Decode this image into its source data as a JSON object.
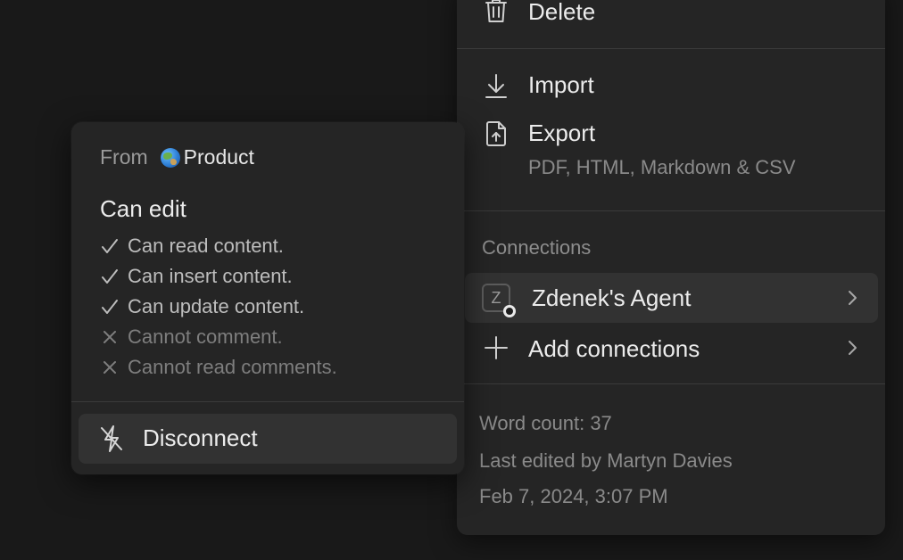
{
  "menu": {
    "delete_label": "Delete",
    "import_label": "Import",
    "export_label": "Export",
    "export_subtext": "PDF, HTML, Markdown & CSV",
    "connections_title": "Connections",
    "agent_initial": "Z",
    "agent_label": "Zdenek's Agent",
    "add_connections_label": "Add connections",
    "word_count": "Word count: 37",
    "last_edited_by": "Last edited by Martyn Davies",
    "last_edited_date": "Feb 7, 2024, 3:07 PM"
  },
  "popover": {
    "from_label": "From",
    "source_icon": "globe-emoji",
    "source_name": "Product",
    "permission_level": "Can edit",
    "permissions": [
      {
        "text": "Can read content.",
        "allowed": true
      },
      {
        "text": "Can insert content.",
        "allowed": true
      },
      {
        "text": "Can update content.",
        "allowed": true
      },
      {
        "text": "Cannot comment.",
        "allowed": false
      },
      {
        "text": "Cannot read comments.",
        "allowed": false
      }
    ],
    "disconnect_label": "Disconnect"
  },
  "colors": {
    "background": "#191919",
    "panel": "#252525",
    "hover": "#323232",
    "text_primary": "#ececec",
    "text_secondary": "#8a8a8a"
  }
}
